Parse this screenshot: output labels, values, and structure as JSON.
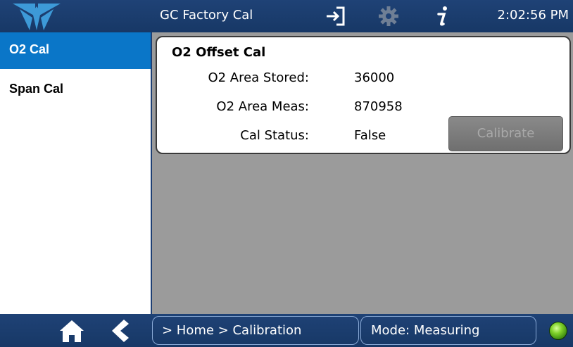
{
  "header": {
    "title": "GC Factory Cal",
    "time": "2:02:56 PM",
    "icons": [
      "logo-icon",
      "sign-in-icon",
      "gear-icon",
      "info-icon"
    ]
  },
  "sidebar": {
    "items": [
      {
        "label": "O2 Cal",
        "active": true
      },
      {
        "label": "Span Cal",
        "active": false
      }
    ]
  },
  "panel": {
    "title": "O2 Offset Cal",
    "rows": [
      {
        "label": "O2 Area Stored:",
        "value": "36000"
      },
      {
        "label": "O2 Area Meas:",
        "value": "870958"
      },
      {
        "label": "Cal Status:",
        "value": "False"
      }
    ],
    "calibrate_label": "Calibrate"
  },
  "footer": {
    "breadcrumb": "> Home > Calibration",
    "mode": "Mode: Measuring",
    "icons": [
      "home-icon",
      "back-icon",
      "status-led-icon"
    ]
  },
  "colors": {
    "bar": "#1f4276",
    "active": "#0a76c8",
    "content_bg": "#9b9b9b",
    "led": "#7fd12a"
  }
}
